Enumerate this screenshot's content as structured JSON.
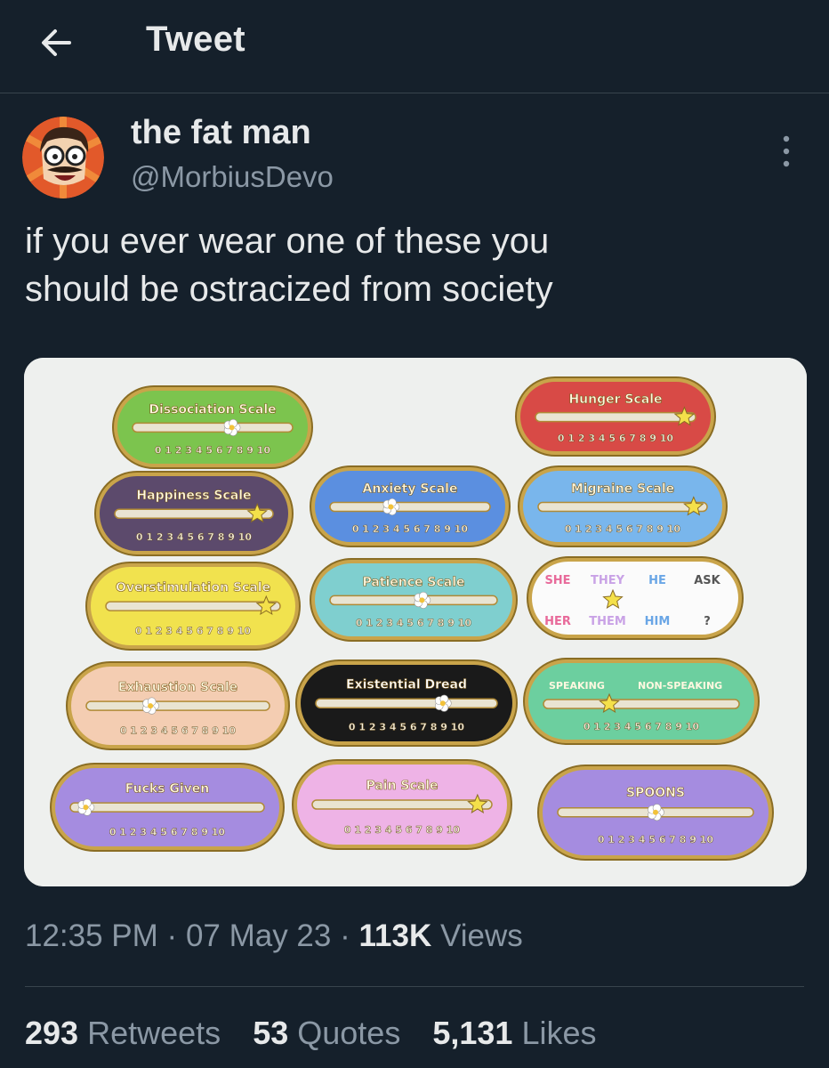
{
  "header": {
    "back_icon": "arrow-left-icon",
    "title": "Tweet"
  },
  "tweet": {
    "author_name": "the fat man",
    "author_handle": "@MorbiusDevo",
    "text_line1": "if you ever wear one of these you",
    "text_line2": "should be ostracized from society",
    "time": "12:35 PM",
    "dot1": "·",
    "date": "07 May 23",
    "dot2": "·",
    "views_count": "113K",
    "views_label": "Views"
  },
  "stats": {
    "retweets_count": "293",
    "retweets_label": "Retweets",
    "quotes_count": "53",
    "quotes_label": "Quotes",
    "likes_count": "5,131",
    "likes_label": "Likes"
  },
  "photo": {
    "pins": [
      {
        "label": "Dissociation Scale",
        "color": "#7cc44e"
      },
      {
        "label": "Hunger Scale",
        "color": "#d84a46"
      },
      {
        "label": "Happiness Scale",
        "color": "#5c4a6c"
      },
      {
        "label": "Anxiety Scale",
        "color": "#5b8fe0"
      },
      {
        "label": "Migraine Scale",
        "color": "#79b6ec"
      },
      {
        "label": "Overstimulation Scale",
        "color": "#f1e24e"
      },
      {
        "label": "Patience Scale",
        "color": "#7fcfcf"
      },
      {
        "label": "Exhaustion Scale",
        "color": "#f4cdb2"
      },
      {
        "label": "Existential Dread",
        "color": "#1a1a1a"
      },
      {
        "label": "Fucks Given",
        "color": "#a58ce0"
      },
      {
        "label": "Pain Scale",
        "color": "#eeb3e6"
      },
      {
        "label": "SPOONS",
        "color": "#a58ce0"
      }
    ],
    "pronoun_pin": {
      "top": [
        "SHE",
        "THEY",
        "HE",
        "ASK"
      ],
      "bottom": [
        "HER",
        "THEM",
        "HIM",
        "?"
      ]
    },
    "speaking_pin": {
      "left": "SPEAKING",
      "right": "NON-SPEAKING",
      "color": "#6ccf9f"
    },
    "scale_numbers": "0 1 2 3 4 5 6 7 8 9 10"
  }
}
